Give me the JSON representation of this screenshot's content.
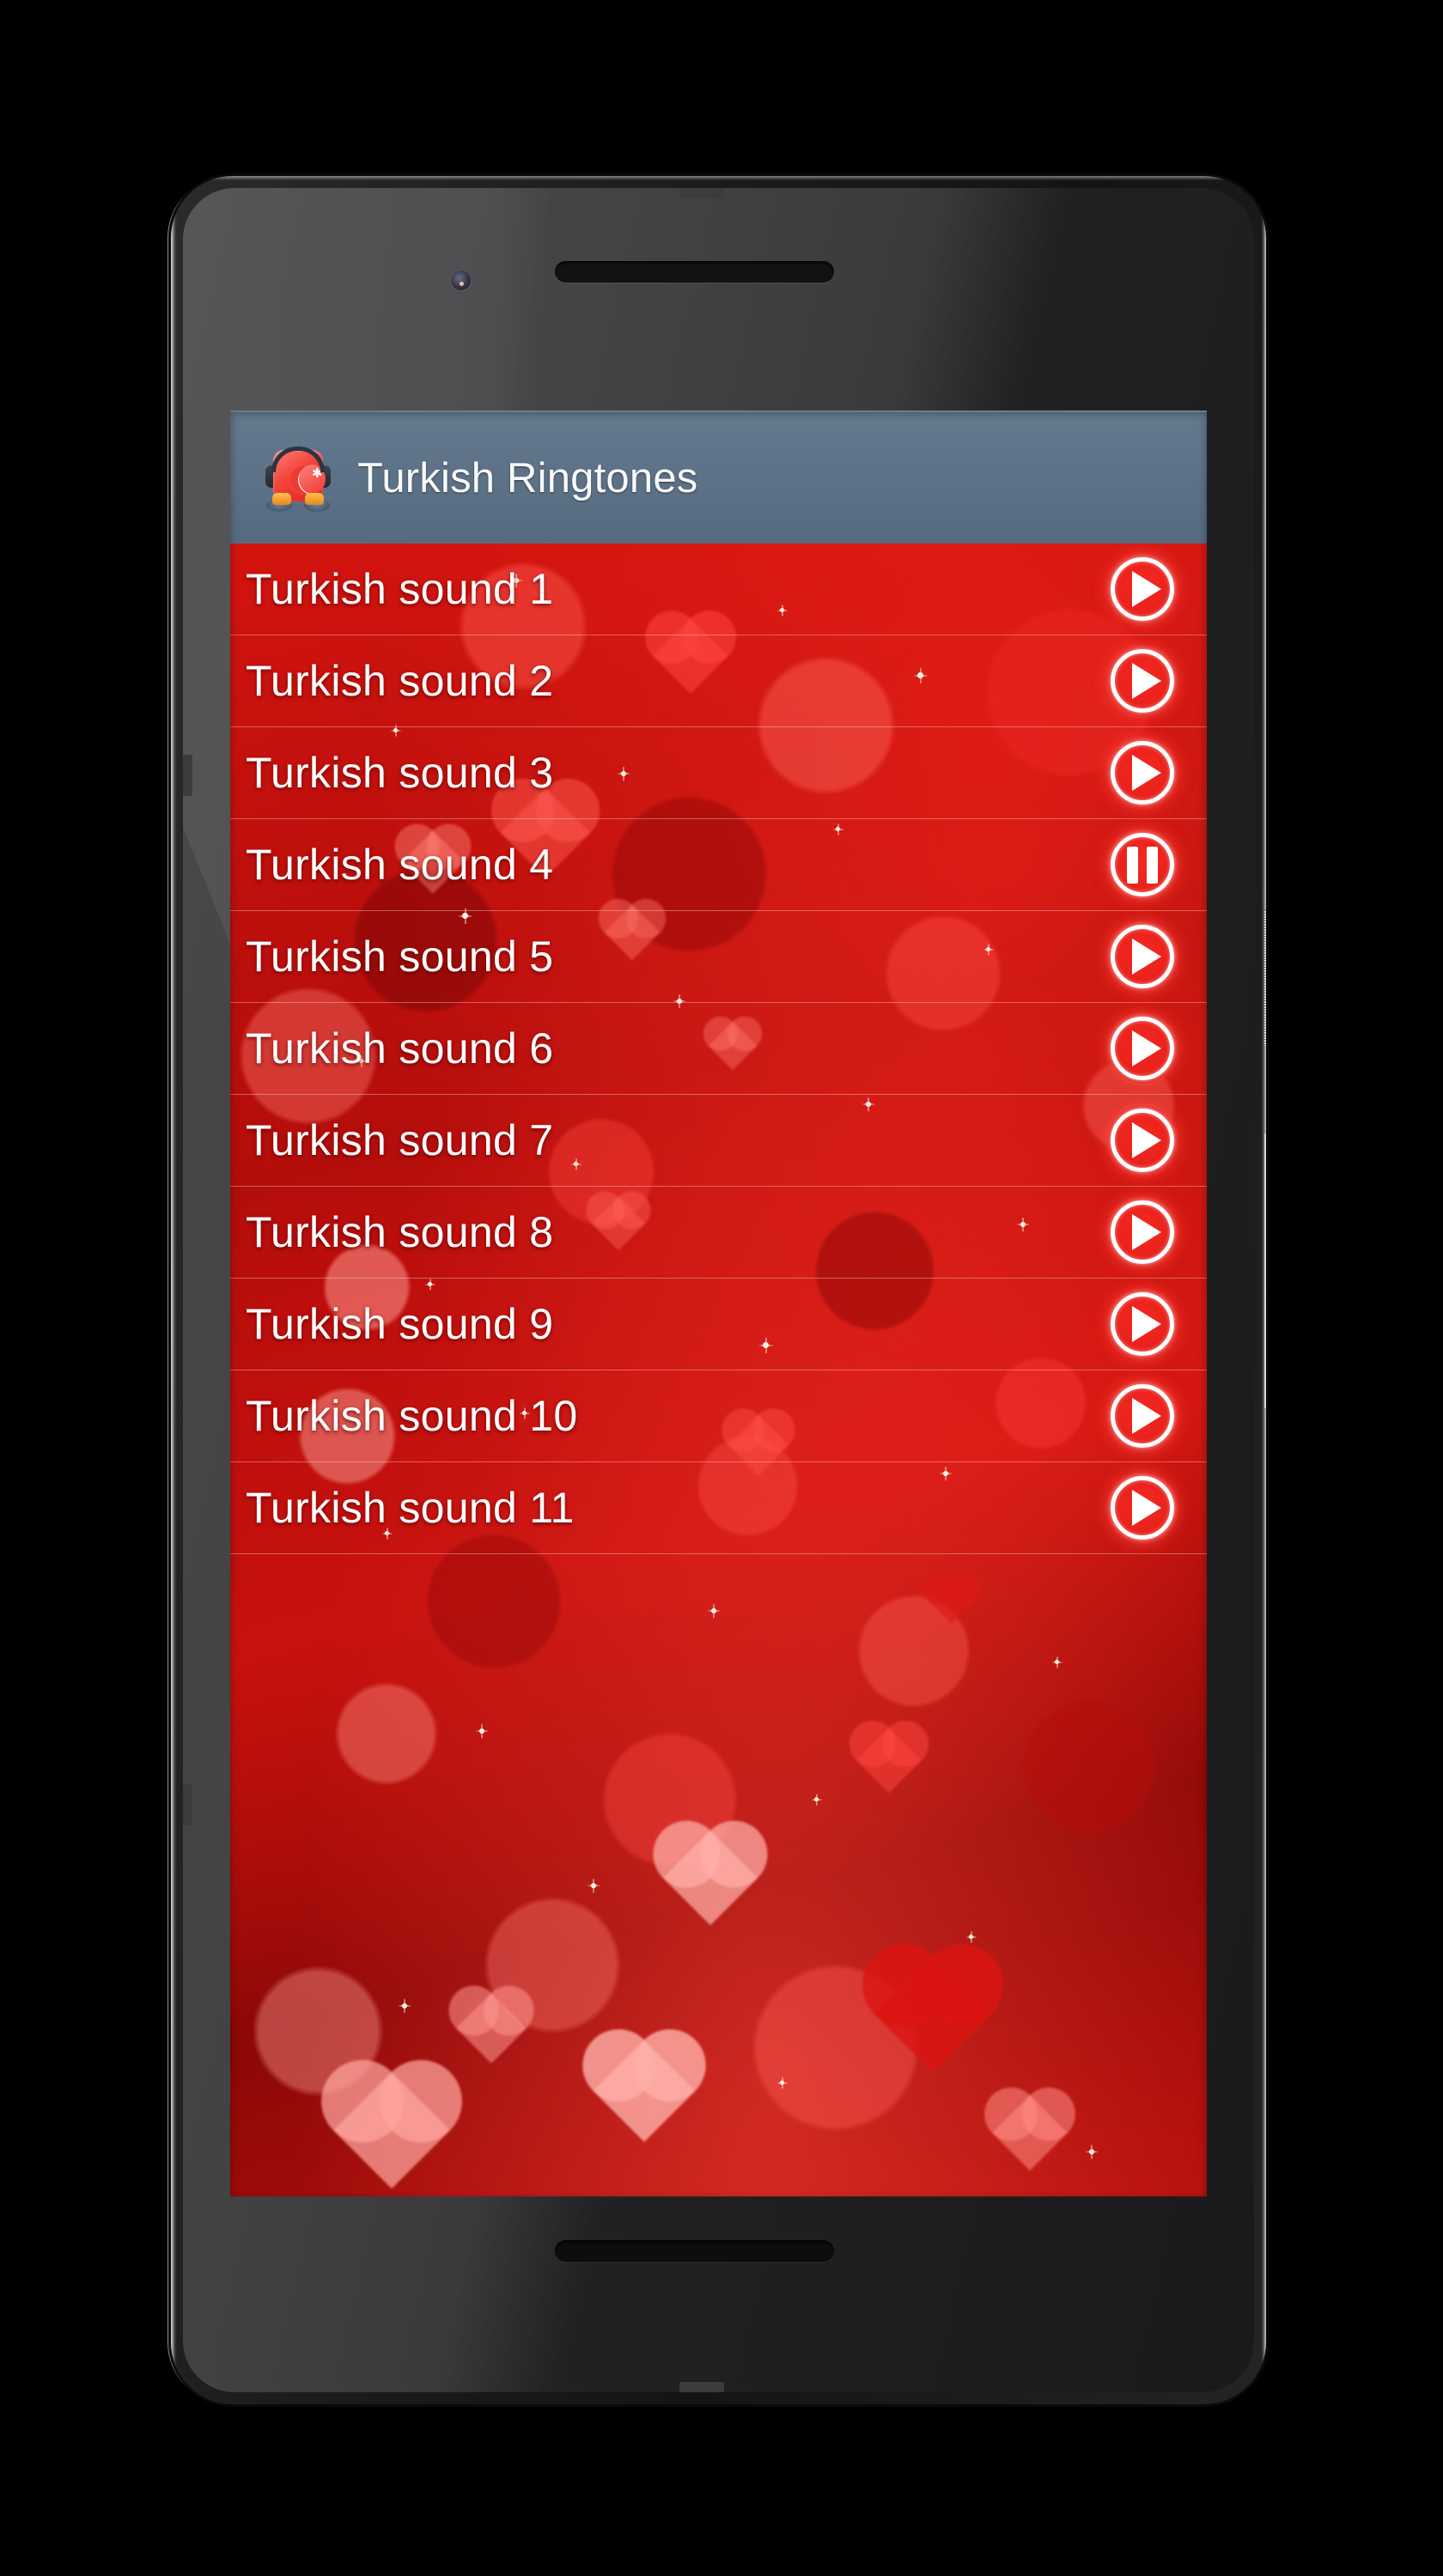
{
  "device": {
    "type": "android-smartphone",
    "earpiece": "earpiece-speaker",
    "front_camera": "front-camera",
    "power_button": "power-button",
    "volume_button": "volume-rocker",
    "chin_speaker": "bottom-speaker"
  },
  "app": {
    "title": "Turkish Ringtones",
    "icon": "turkish-flag-headphones-icon",
    "action_bar_color": "#5c7185",
    "accent_color": "#e8201a",
    "background_color": "#c2110f",
    "text_color": "#ffffff"
  },
  "list": {
    "rows": [
      {
        "label": "Turkish sound 1",
        "control": "play",
        "control_label": "Play"
      },
      {
        "label": "Turkish sound 2",
        "control": "play",
        "control_label": "Play"
      },
      {
        "label": "Turkish sound 3",
        "control": "play",
        "control_label": "Play"
      },
      {
        "label": "Turkish sound 4",
        "control": "pause",
        "control_label": "Pause"
      },
      {
        "label": "Turkish sound 5",
        "control": "play",
        "control_label": "Play"
      },
      {
        "label": "Turkish sound 6",
        "control": "play",
        "control_label": "Play"
      },
      {
        "label": "Turkish sound 7",
        "control": "play",
        "control_label": "Play"
      },
      {
        "label": "Turkish sound 8",
        "control": "play",
        "control_label": "Play"
      },
      {
        "label": "Turkish sound 9",
        "control": "play",
        "control_label": "Play"
      },
      {
        "label": "Turkish sound 10",
        "control": "play",
        "control_label": "Play"
      },
      {
        "label": "Turkish sound 11",
        "control": "play",
        "control_label": "Play"
      }
    ]
  }
}
